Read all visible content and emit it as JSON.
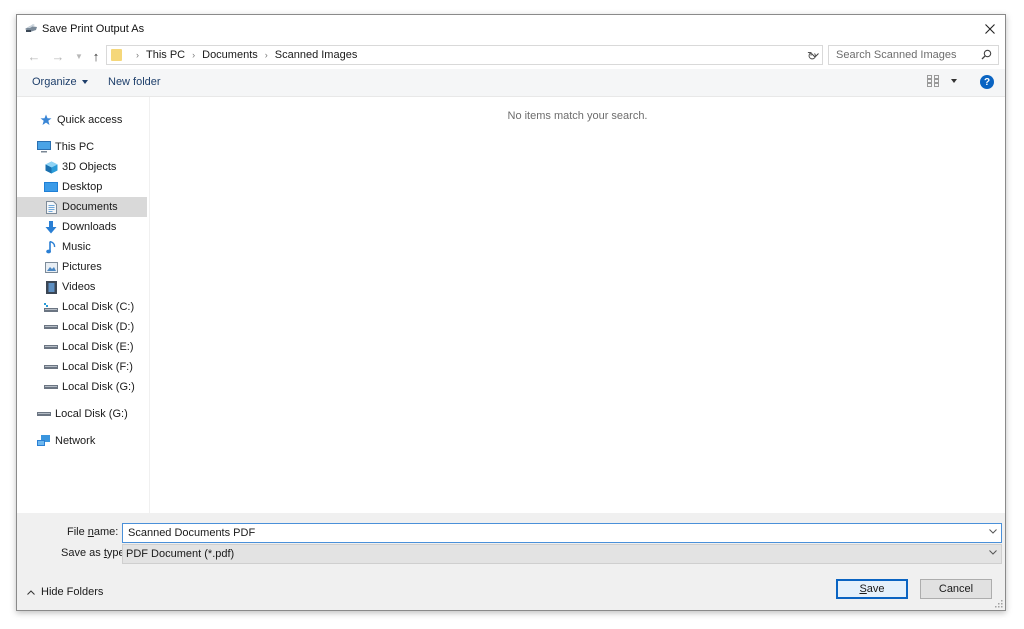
{
  "window": {
    "title": "Save Print Output As",
    "close_icon": "close-icon"
  },
  "navigation": {
    "back_icon": "arrow-left-icon",
    "forward_icon": "arrow-right-icon",
    "recent_icon": "chevron-down-icon",
    "up_icon": "arrow-up-icon",
    "breadcrumb": [
      "This PC",
      "Documents",
      "Scanned Images"
    ],
    "refresh_icon": "refresh-icon",
    "search_placeholder": "Search Scanned Images"
  },
  "toolbar": {
    "organize_label": "Organize",
    "new_folder_label": "New folder",
    "view_icon": "view-options-icon",
    "help_label": "?"
  },
  "sidebar": {
    "items": [
      {
        "label": "Quick access",
        "icon": "star-icon",
        "selected": false
      },
      {
        "label": "This PC",
        "icon": "computer-icon",
        "selected": false
      },
      {
        "label": "3D Objects",
        "icon": "cube-icon",
        "selected": false
      },
      {
        "label": "Desktop",
        "icon": "desktop-icon",
        "selected": false
      },
      {
        "label": "Documents",
        "icon": "document-icon",
        "selected": true
      },
      {
        "label": "Downloads",
        "icon": "download-icon",
        "selected": false
      },
      {
        "label": "Music",
        "icon": "music-icon",
        "selected": false
      },
      {
        "label": "Pictures",
        "icon": "picture-icon",
        "selected": false
      },
      {
        "label": "Videos",
        "icon": "video-icon",
        "selected": false
      },
      {
        "label": "Local Disk (C:)",
        "icon": "system-drive-icon",
        "selected": false
      },
      {
        "label": "Local Disk (D:)",
        "icon": "drive-icon",
        "selected": false
      },
      {
        "label": "Local Disk (E:)",
        "icon": "drive-icon",
        "selected": false
      },
      {
        "label": "Local Disk (F:)",
        "icon": "drive-icon",
        "selected": false
      },
      {
        "label": "Local Disk (G:)",
        "icon": "drive-icon",
        "selected": false
      },
      {
        "label": "Local Disk (G:)",
        "icon": "drive-icon",
        "selected": false
      },
      {
        "label": "Network",
        "icon": "network-icon",
        "selected": false
      }
    ]
  },
  "content": {
    "empty_message": "No items match your search."
  },
  "form": {
    "file_name_label_pre": "File ",
    "file_name_label_ul": "n",
    "file_name_label_post": "ame:",
    "file_name_value": "Scanned Documents PDF",
    "save_type_label_pre": "Save as ",
    "save_type_label_ul": "t",
    "save_type_label_post": "ype:",
    "save_type_value": "PDF Document (*.pdf)"
  },
  "footer": {
    "hide_folders_label": "Hide Folders",
    "save_label_ul": "S",
    "save_label_rest": "ave",
    "cancel_label": "Cancel"
  },
  "colors": {
    "accent": "#0a64c2",
    "selection": "#d9d9d9",
    "folder": "#f5d77a"
  }
}
